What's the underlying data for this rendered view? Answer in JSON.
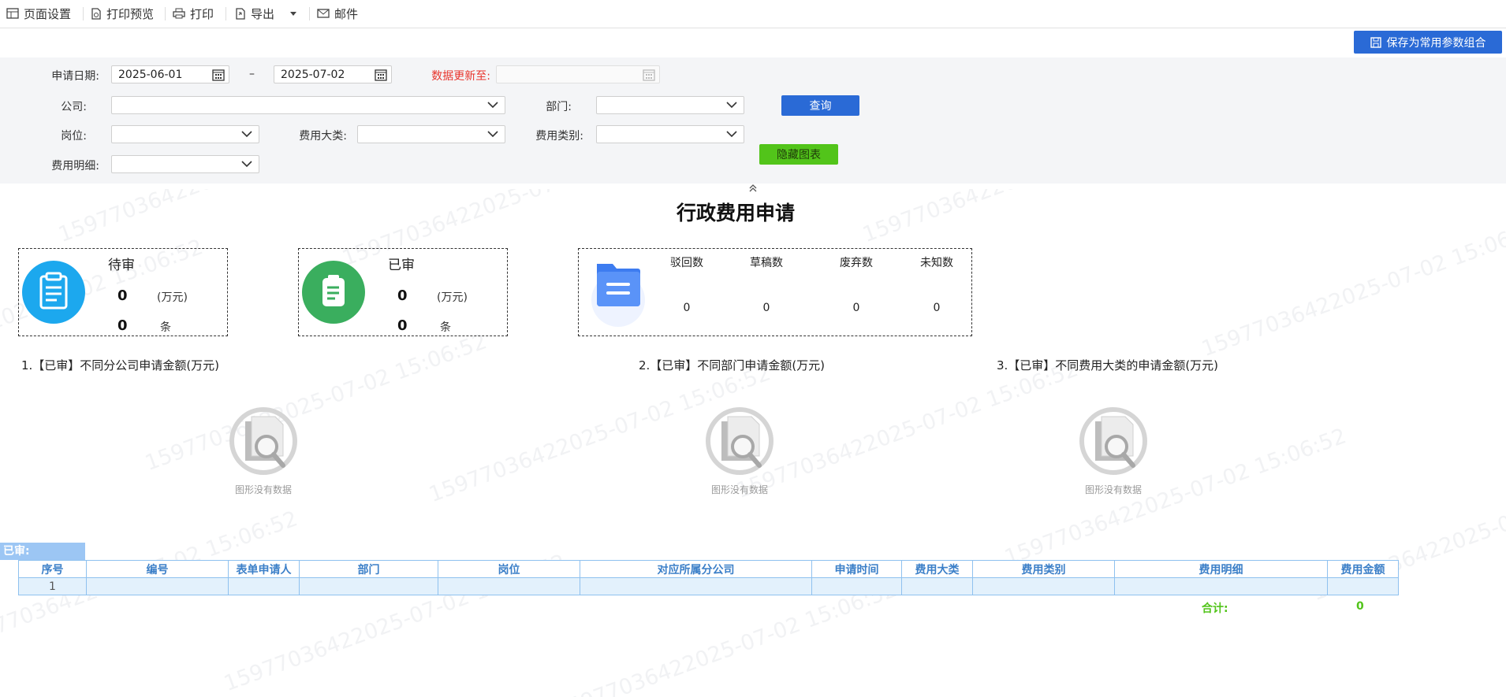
{
  "toolbar": {
    "page_setup": "页面设置",
    "print_preview": "打印预览",
    "print": "打印",
    "export": "导出",
    "mail": "邮件"
  },
  "save_params_button": "保存为常用参数组合",
  "filters": {
    "apply_date_label": "申请日期:",
    "date_from": "2025-06-01",
    "date_sep": "–",
    "date_to": "2025-07-02",
    "data_updated_label": "数据更新至:",
    "data_updated_value": "",
    "company_label": "公司:",
    "company_value": "",
    "department_label": "部门:",
    "department_value": "",
    "query_button": "查询",
    "position_label": "岗位:",
    "position_value": "",
    "expense_major_label": "费用大类:",
    "expense_major_value": "",
    "expense_category_label": "费用类别:",
    "expense_category_value": "",
    "hide_chart_button": "隐藏图表",
    "expense_detail_label": "费用明细:",
    "expense_detail_value": ""
  },
  "watermark": "15977036422025-07-02 15:06:52",
  "title": "行政费用申请",
  "cards": {
    "pending": {
      "title": "待审",
      "amount": "0",
      "amount_unit": "(万元)",
      "count": "0",
      "count_unit": "条"
    },
    "approved": {
      "title": "已审",
      "amount": "0",
      "amount_unit": "(万元)",
      "count": "0",
      "count_unit": "条"
    },
    "status": {
      "columns": [
        {
          "label": "驳回数",
          "value": "0"
        },
        {
          "label": "草稿数",
          "value": "0"
        },
        {
          "label": "废弃数",
          "value": "0"
        },
        {
          "label": "未知数",
          "value": "0"
        }
      ]
    }
  },
  "charts": [
    {
      "title": "1.【已审】不同分公司申请金额(万元)",
      "empty_text": "图形没有数据"
    },
    {
      "title": "2.【已审】不同部门申请金额(万元)",
      "empty_text": "图形没有数据"
    },
    {
      "title": "3.【已审】不同费用大类的申请金额(万元)",
      "empty_text": "图形没有数据"
    }
  ],
  "table": {
    "section_label": "已审:",
    "headers": [
      "序号",
      "编号",
      "表单申请人",
      "部门",
      "岗位",
      "对应所属分公司",
      "申请时间",
      "费用大类",
      "费用类别",
      "费用明细",
      "费用金额"
    ],
    "rows": [
      [
        "1",
        "",
        "",
        "",
        "",
        "",
        "",
        "",
        "",
        "",
        ""
      ]
    ],
    "total_label": "合计:",
    "total_value": "0"
  },
  "colors": {
    "primary": "#2a6ad6",
    "success": "#52c41a",
    "card_blue": "#1ca8ee",
    "card_green": "#3aae5e"
  }
}
